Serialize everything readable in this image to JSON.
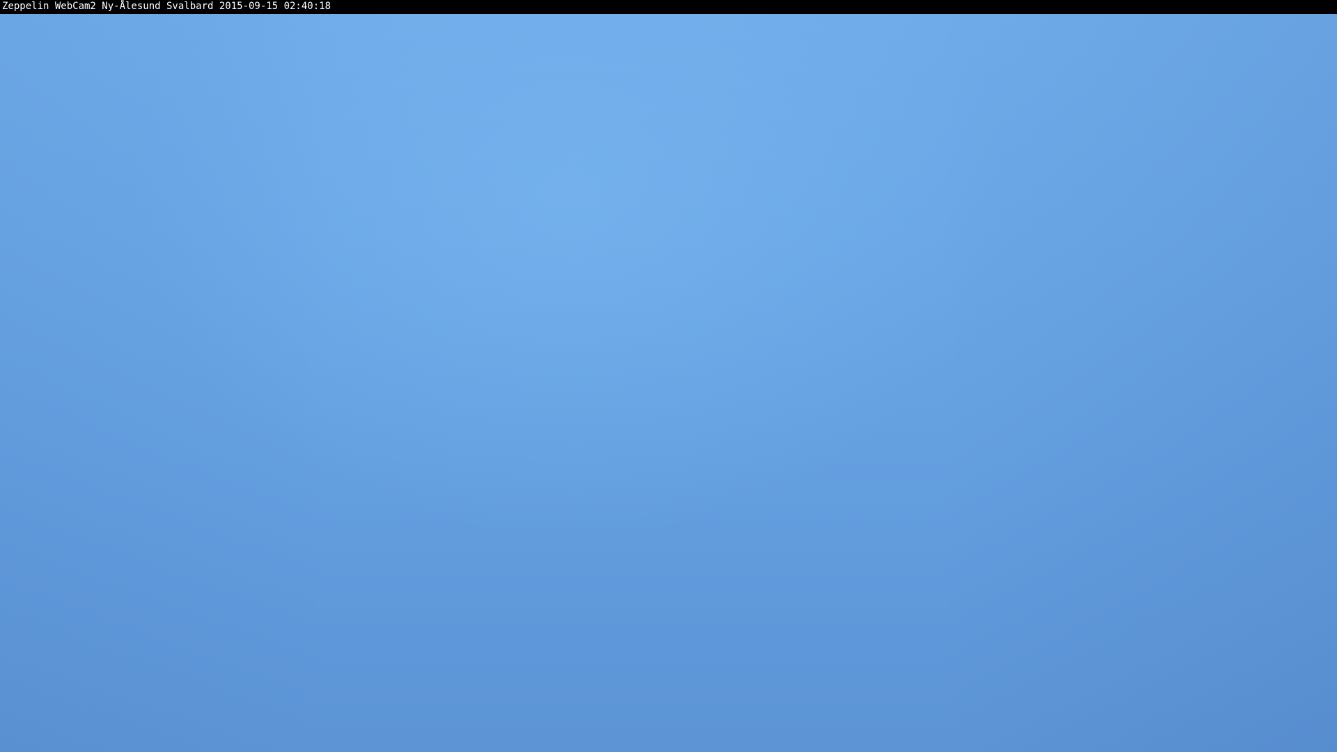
{
  "overlay": {
    "caption": "Zeppelin WebCam2 Ny-Ålesund Svalbard 2015-09-15 02:40:18"
  },
  "colors": {
    "caption_bar": "#000000",
    "caption_text": "#ffffff",
    "sky_top": "#6fabe9",
    "sky_bottom": "#5c94d6"
  }
}
